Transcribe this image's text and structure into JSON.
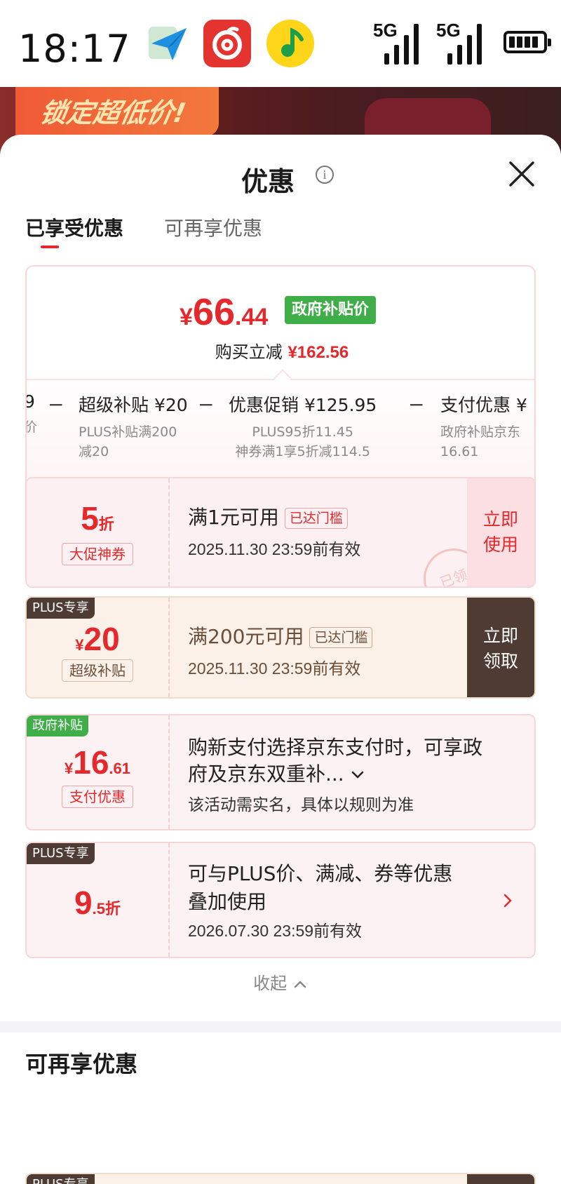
{
  "status": {
    "time": "18:17",
    "signal1": "5G",
    "signal2": "5G"
  },
  "backdrop": {
    "promo_text": "锁定超低价!"
  },
  "sheet": {
    "title": "优惠",
    "tabs": [
      "已享受优惠",
      "可再享优惠"
    ]
  },
  "summary": {
    "price_symbol": "¥",
    "price_int": "66",
    "price_dec": ".44",
    "gov_tag": "政府补贴价",
    "sub_label": "购买立减",
    "sub_amount": "¥162.56",
    "breakdown": [
      {
        "title": "9",
        "desc1": "价",
        "desc2": ""
      },
      {
        "title": "超级补贴 ¥20",
        "desc1": "PLUS补贴满200",
        "desc2": "减20"
      },
      {
        "title": "优惠促销 ¥125.95",
        "desc1": "PLUS95折11.45",
        "desc2": "神券满1享5折减114.5"
      },
      {
        "title": "支付优惠 ¥",
        "desc1": "政府补贴京东",
        "desc2": "16.61"
      }
    ],
    "minus": "−"
  },
  "coupons": [
    {
      "value_big": "5",
      "value_small": "折",
      "label": "大促神券",
      "title": "满1元可用",
      "reach": "已达门槛",
      "date": "2025.11.30 23:59前有效",
      "action_line1": "立即",
      "action_line2": "使用",
      "stamp": "已领"
    },
    {
      "corner": "PLUS专享",
      "value_pre": "¥",
      "value_big": "20",
      "label": "超级补贴",
      "title": "满200元可用",
      "reach": "已达门槛",
      "date": "2025.11.30 23:59前有效",
      "action_line1": "立即",
      "action_line2": "领取"
    },
    {
      "corner": "政府补贴",
      "value_pre": "¥",
      "value_big": "16",
      "value_dec": ".61",
      "label": "支付优惠",
      "title_line1": "购新支付选择京东支付时，可享政",
      "title_line2": "府及京东双重补...",
      "note": "该活动需实名，具体以规则为准"
    },
    {
      "corner": "PLUS专享",
      "value_big": "9",
      "value_small": ".5折",
      "title_line1": "可与PLUS价、满减、券等优惠",
      "title_line2": "叠加使用",
      "date": "2026.07.30 23:59前有效"
    }
  ],
  "collapse_label": "收起",
  "section2_title": "可再享优惠",
  "peek_corner": "PLUS专享",
  "colors": {
    "accent_red": "#e4282b",
    "gov_green": "#3fae48",
    "plus_brown": "#4e3b33"
  },
  "icons": [
    "send-app-icon",
    "netease-music-app-icon",
    "qq-music-app-icon",
    "signal-icon",
    "battery-icon",
    "info-icon",
    "close-icon",
    "chevron-down-icon",
    "chevron-right-icon",
    "chevron-up-icon"
  ]
}
